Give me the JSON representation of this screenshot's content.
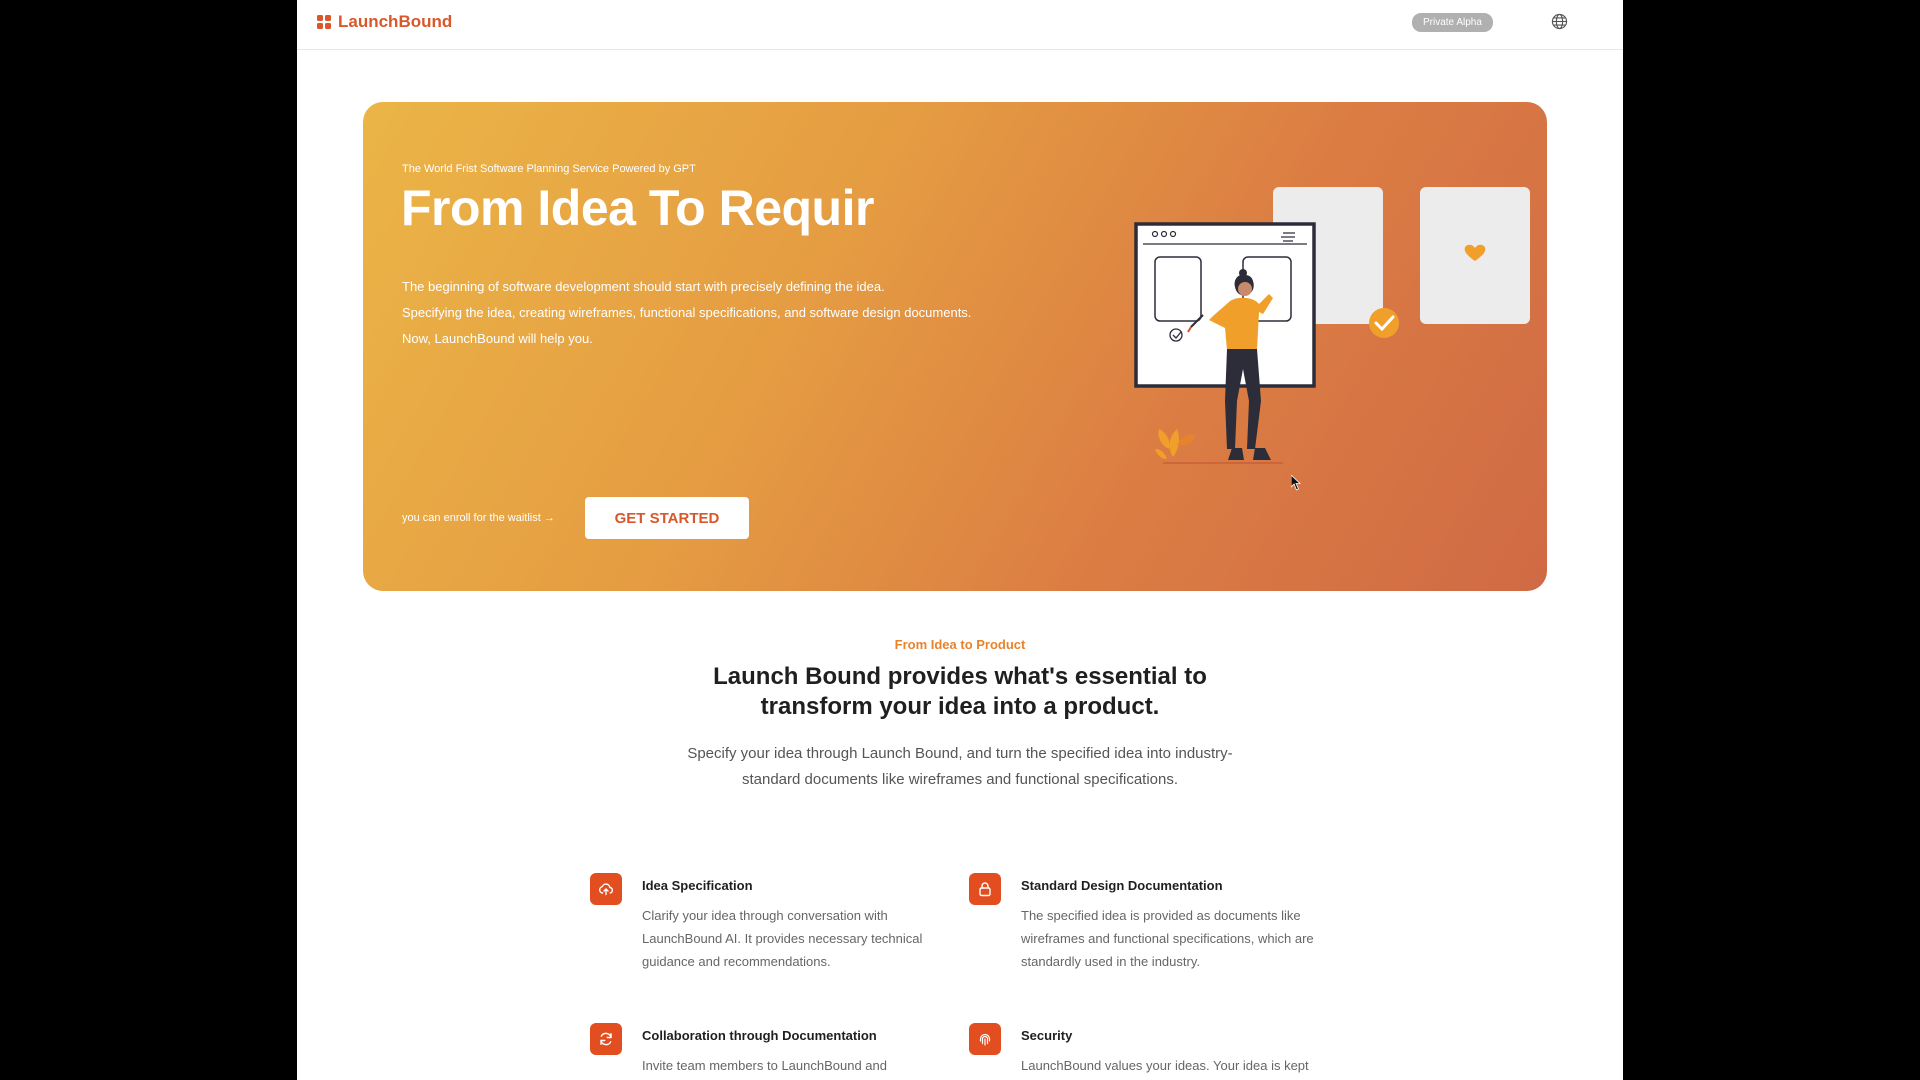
{
  "nav": {
    "brand": "LaunchBound",
    "badge": "Private Alpha"
  },
  "hero": {
    "eyebrow": "The World Frist Software Planning Service Powered by GPT",
    "title": "From Idea To Requir",
    "description": [
      "The beginning of software development should start with precisely defining the idea.",
      "Specifying the idea, creating wireframes, functional specifications, and software design documents.",
      "Now, LaunchBound will help you."
    ],
    "waitlist_note": "you can enroll for the waitlist →",
    "cta_label": "GET STARTED"
  },
  "features_intro": {
    "eyebrow": "From Idea to Product",
    "title_lines": [
      "Launch Bound provides what's essential to",
      "transform your idea into a product."
    ],
    "subtitle_lines": [
      "Specify your idea through Launch Bound, and turn the specified idea into industry-",
      "standard documents like wireframes and functional specifications."
    ]
  },
  "features": [
    {
      "icon": "cloud-upload-icon",
      "title": "Idea Specification",
      "description": [
        "Clarify your idea through conversation with",
        "LaunchBound AI. It provides necessary technical",
        "guidance and recommendations."
      ]
    },
    {
      "icon": "lock-icon",
      "title": "Standard Design Documentation",
      "description": [
        "The specified idea is provided as documents like",
        "wireframes and functional specifications, which are",
        "standardly used in the industry."
      ]
    },
    {
      "icon": "refresh-icon",
      "title": "Collaboration through Documentation",
      "description": [
        "Invite team members to LaunchBound and"
      ]
    },
    {
      "icon": "fingerprint-icon",
      "title": "Security",
      "description": [
        "LaunchBound values your ideas. Your idea is kept"
      ]
    }
  ],
  "colors": {
    "accent": "#e24e1f",
    "brand": "#d9572b",
    "eyebrow": "#e8832d"
  }
}
